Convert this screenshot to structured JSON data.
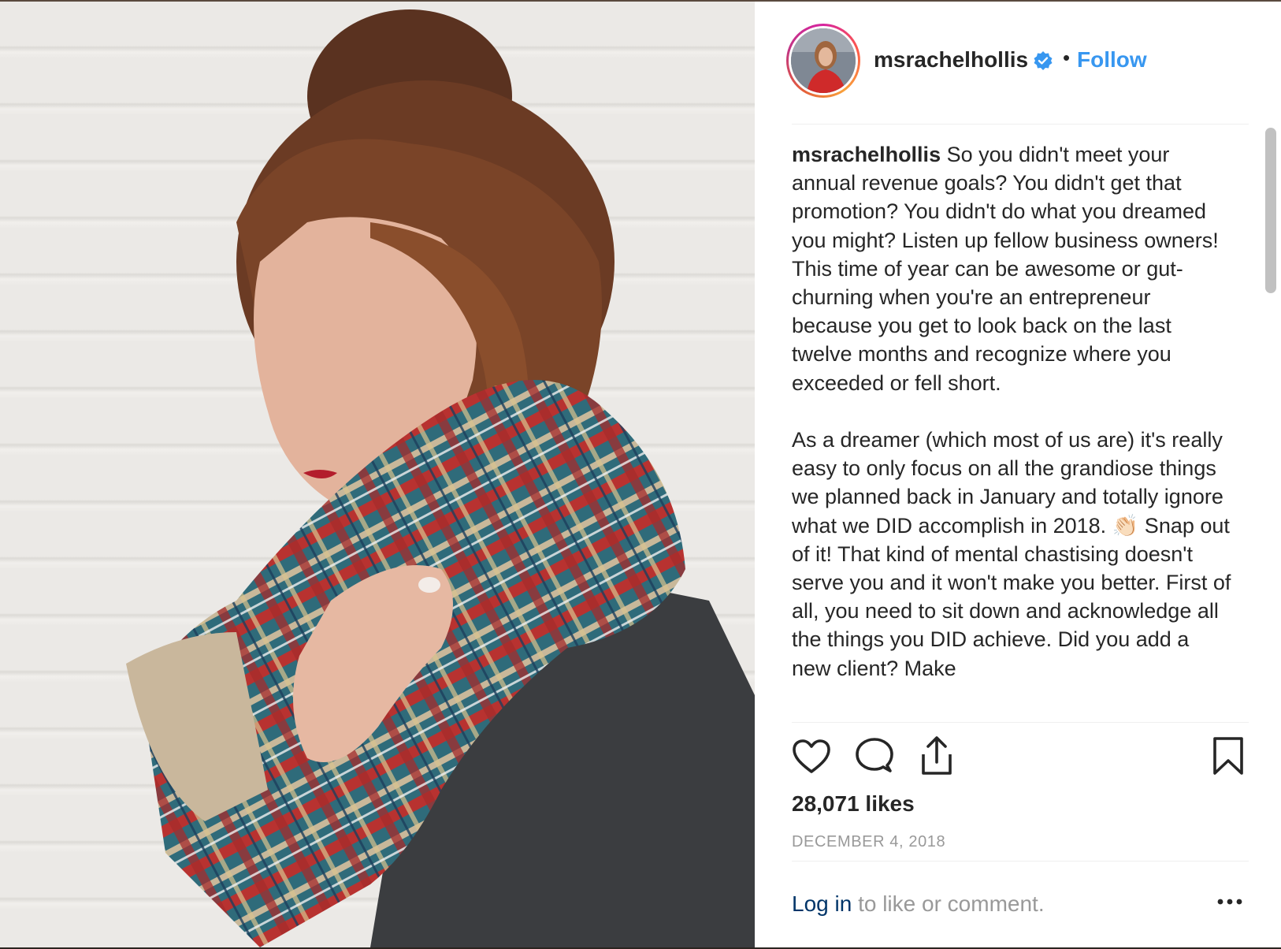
{
  "post": {
    "username": "msrachelhollis",
    "separator": "•",
    "follow_label": "Follow",
    "caption_username": "msrachelhollis",
    "caption_text": " So you didn't meet your annual revenue goals? You didn't get that promotion? You didn't do what you dreamed you might? Listen up fellow business owners! This time of year can be awesome or gut-churning when you're an entrepreneur because you get to look back on the last twelve months and recognize where you exceeded or fell short.\n\nAs a dreamer (which most of us are) it's really easy to only focus on all the grandiose things we planned back in January and totally ignore what we DID accomplish in 2018. 👏🏻 Snap out of it! That kind of mental chastising doesn't serve you and it won't make you better. First of all, you need to sit down and acknowledge all the things you DID achieve. Did you add a new client? Make",
    "likes": "28,071 likes",
    "date": "DECEMBER 4, 2018",
    "login_link": "Log in",
    "login_rest": " to like or comment."
  },
  "icons": {
    "verified": "verified-badge-icon",
    "like": "heart-icon",
    "comment": "comment-bubble-icon",
    "share": "share-icon",
    "save": "bookmark-icon",
    "more": "more-options-icon"
  },
  "colors": {
    "accent": "#3897f0",
    "text": "#262626",
    "muted": "#999999",
    "link": "#003569"
  }
}
